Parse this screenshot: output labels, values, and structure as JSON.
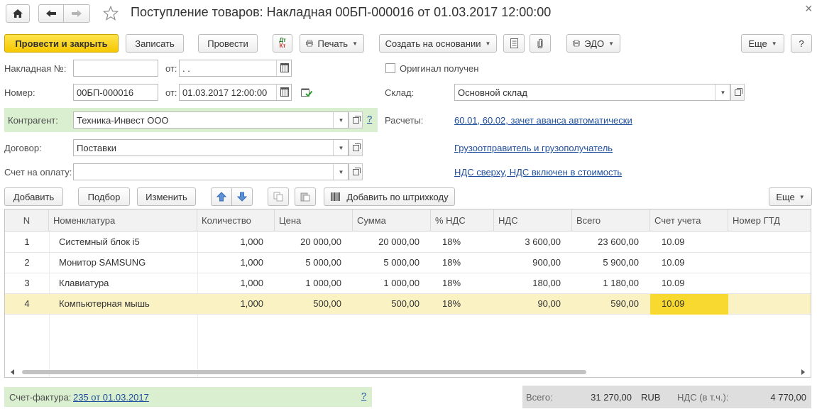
{
  "window": {
    "title": "Поступление товаров: Накладная 00БП-000016 от 01.03.2017 12:00:00",
    "close_glyph": "×"
  },
  "toolbar": {
    "post_close": "Провести и закрыть",
    "save": "Записать",
    "post": "Провести",
    "dtkt_top": "Дт",
    "dtkt_bottom": "Кт",
    "print": "Печать",
    "create_based": "Создать на основании",
    "edo": "ЭДО",
    "more": "Еще",
    "help": "?"
  },
  "form": {
    "invoice_no_label": "Накладная №:",
    "invoice_no_value": "",
    "from_label": "от:",
    "invoice_date_value": " .  .",
    "original_received_label": "Оригинал получен",
    "number_label": "Номер:",
    "number_value": "00БП-000016",
    "date_value": "01.03.2017 12:00:00",
    "warehouse_label": "Склад:",
    "warehouse_value": "Основной склад",
    "counterparty_label": "Контрагент:",
    "counterparty_value": "Техника-Инвест ООО",
    "counterparty_help": "?",
    "settlements_label": "Расчеты:",
    "settlements_link": "60.01, 60.02, зачет аванса автоматически",
    "contract_label": "Договор:",
    "contract_value": "Поставки",
    "shipper_link": "Грузоотправитель и грузополучатель",
    "payment_invoice_label": "Счет на оплату:",
    "payment_invoice_value": "",
    "vat_link": "НДС сверху, НДС включен в стоимость"
  },
  "table_toolbar": {
    "add": "Добавить",
    "pick": "Подбор",
    "edit": "Изменить",
    "add_barcode": "Добавить по штрихкоду",
    "more": "Еще"
  },
  "table": {
    "headers": [
      "N",
      "Номенклатура",
      "Количество",
      "Цена",
      "Сумма",
      "% НДС",
      "НДС",
      "Всего",
      "Счет учета",
      "Номер ГТД"
    ],
    "rows": [
      [
        "1",
        "Системный блок i5",
        "1,000",
        "20 000,00",
        "20 000,00",
        "18%",
        "3 600,00",
        "23 600,00",
        "10.09",
        ""
      ],
      [
        "2",
        "Монитор SAMSUNG",
        "1,000",
        "5 000,00",
        "5 000,00",
        "18%",
        "900,00",
        "5 900,00",
        "10.09",
        ""
      ],
      [
        "3",
        "Клавиатура",
        "1,000",
        "1 000,00",
        "1 000,00",
        "18%",
        "180,00",
        "1 180,00",
        "10.09",
        ""
      ],
      [
        "4",
        "Компьютерная мышь",
        "1,000",
        "500,00",
        "500,00",
        "18%",
        "90,00",
        "590,00",
        "10.09",
        ""
      ]
    ],
    "selected_row": 3
  },
  "footer": {
    "invoice_label": "Счет-фактура:",
    "invoice_link": "235 от 01.03.2017",
    "invoice_help": "?",
    "total_label": "Всего:",
    "total_value": "31 270,00",
    "currency": "RUB",
    "vat_label": "НДС (в т.ч.):",
    "vat_value": "4 770,00"
  },
  "colors": {
    "accent_yellow": "#f5c800",
    "green_band": "#d9efd0",
    "link_blue": "#1f4e9c",
    "selected_row": "#fbf2c4",
    "highlight_cell": "#f8d92f"
  }
}
